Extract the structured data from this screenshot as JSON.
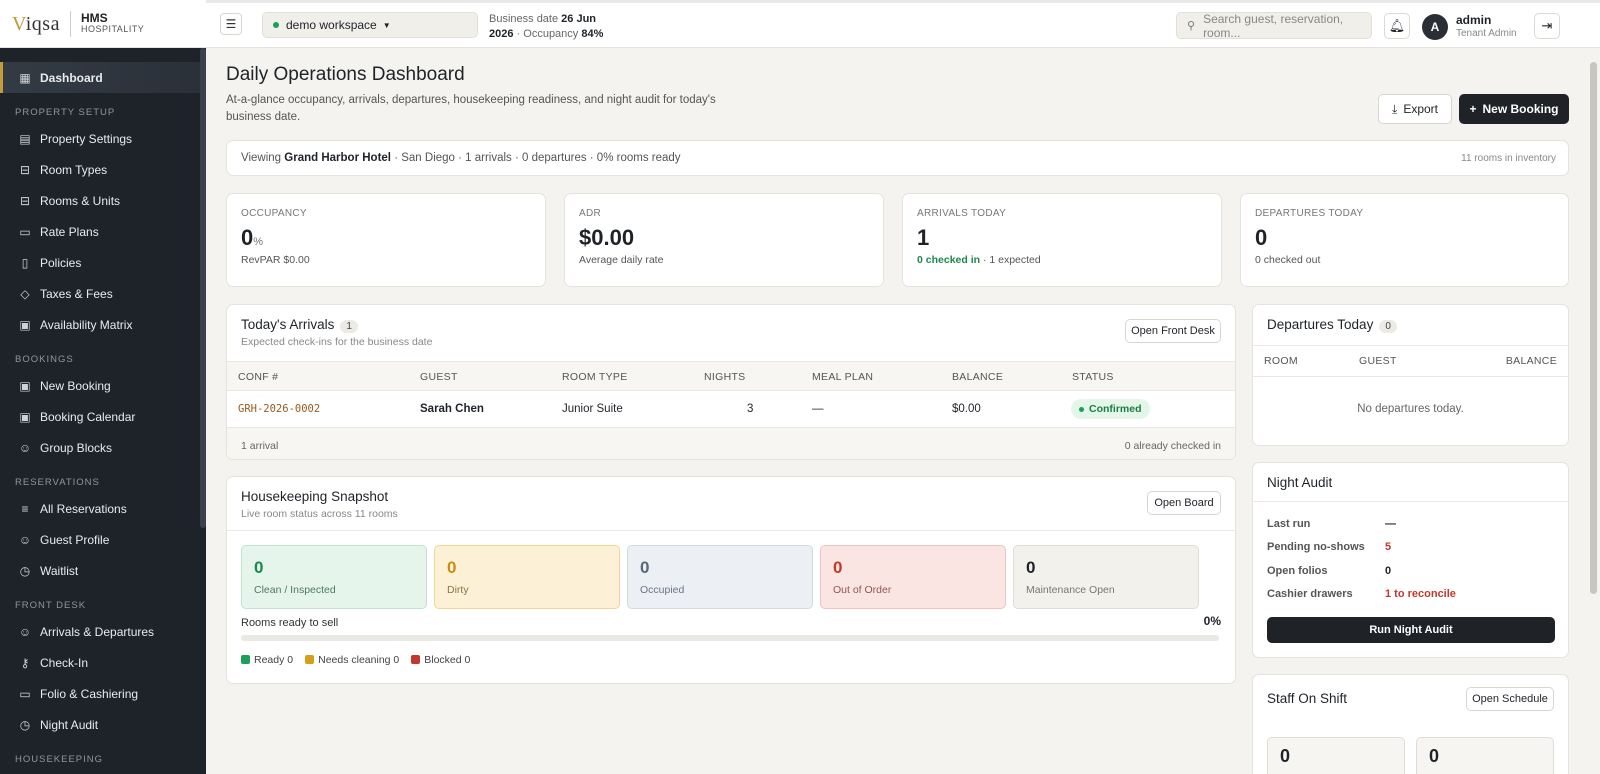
{
  "brand": {
    "logo_prefix": "V",
    "logo_rest": "iqsa",
    "name_line1": "HMS",
    "name_line2": "HOSPITALITY"
  },
  "sidebar": {
    "items": [
      {
        "label": "Dashboard"
      },
      {
        "section": "PROPERTY SETUP"
      },
      {
        "label": "Property Settings"
      },
      {
        "label": "Room Types"
      },
      {
        "label": "Rooms & Units"
      },
      {
        "label": "Rate Plans"
      },
      {
        "label": "Policies"
      },
      {
        "label": "Taxes & Fees"
      },
      {
        "label": "Availability Matrix"
      },
      {
        "section": "BOOKINGS"
      },
      {
        "label": "New Booking"
      },
      {
        "label": "Booking Calendar"
      },
      {
        "label": "Group Blocks"
      },
      {
        "section": "RESERVATIONS"
      },
      {
        "label": "All Reservations"
      },
      {
        "label": "Guest Profile"
      },
      {
        "label": "Waitlist"
      },
      {
        "section": "FRONT DESK"
      },
      {
        "label": "Arrivals & Departures"
      },
      {
        "label": "Check-In"
      },
      {
        "label": "Folio & Cashiering"
      },
      {
        "label": "Night Audit"
      },
      {
        "section": "HOUSEKEEPING"
      }
    ]
  },
  "topbar": {
    "workspace": "demo workspace",
    "business_date_label": "Business date",
    "business_date_value": "26 Jun",
    "business_year": "2026",
    "occupancy_label": "· Occupancy",
    "occupancy_value": "84%",
    "search_placeholder": "Search guest, reservation, room...",
    "avatar_initial": "A",
    "user_name": "admin",
    "user_role": "Tenant Admin"
  },
  "page": {
    "title": "Daily Operations Dashboard",
    "subtitle": "At-a-glance occupancy, arrivals, departures, housekeeping readiness, and night audit for today's business date.",
    "export_label": "Export",
    "new_booking_label": "New Booking"
  },
  "viewing": {
    "prefix": "Viewing",
    "hotel": "Grand Harbor Hotel",
    "details": "· San Diego · 1 arrivals · 0 departures · 0% rooms ready",
    "inventory": "11 rooms in inventory"
  },
  "kpis": {
    "occupancy": {
      "label": "OCCUPANCY",
      "value": "0",
      "unit": "%",
      "sub": "RevPAR $0.00"
    },
    "adr": {
      "label": "ADR",
      "value": "$0.00",
      "sub": "Average daily rate"
    },
    "arrivals": {
      "label": "ARRIVALS TODAY",
      "value": "1",
      "sub_green": "0 checked in",
      "sub_rest": "· 1 expected"
    },
    "departures": {
      "label": "DEPARTURES TODAY",
      "value": "0",
      "sub": "0 checked out"
    }
  },
  "arrivals": {
    "title": "Today's Arrivals",
    "count": "1",
    "subtitle": "Expected check-ins for the business date",
    "open_label": "Open Front Desk",
    "columns": [
      "CONF #",
      "GUEST",
      "ROOM TYPE",
      "NIGHTS",
      "MEAL PLAN",
      "BALANCE",
      "STATUS"
    ],
    "rows": [
      {
        "conf": "GRH-2026-0002",
        "guest": "Sarah Chen",
        "room_type": "Junior Suite",
        "nights": "3",
        "meal_plan": "—",
        "balance": "$0.00",
        "status": "Confirmed"
      }
    ],
    "footer_left": "1 arrival",
    "footer_right": "0 already checked in"
  },
  "housekeeping": {
    "title": "Housekeeping Snapshot",
    "subtitle": "Live room status across 11 rooms",
    "open_label": "Open Board",
    "boxes": [
      {
        "value": "0",
        "label": "Clean / Inspected"
      },
      {
        "value": "0",
        "label": "Dirty"
      },
      {
        "value": "0",
        "label": "Occupied"
      },
      {
        "value": "0",
        "label": "Out of Order"
      },
      {
        "value": "0",
        "label": "Maintenance Open"
      }
    ],
    "ready_label": "Rooms ready to sell",
    "ready_pct": "0%",
    "ready_fraction": 0,
    "legend": [
      {
        "label": "Ready 0",
        "color": "#1a9f5c"
      },
      {
        "label": "Needs cleaning 0",
        "color": "#d4a017"
      },
      {
        "label": "Blocked 0",
        "color": "#c0392b"
      }
    ]
  },
  "departures": {
    "title": "Departures Today",
    "count": "0",
    "columns": [
      "ROOM",
      "GUEST",
      "BALANCE"
    ],
    "empty": "No departures today."
  },
  "night_audit": {
    "title": "Night Audit",
    "rows": [
      {
        "key": "Last run",
        "value": "—"
      },
      {
        "key": "Pending no-shows",
        "value": "5"
      },
      {
        "key": "Open folios",
        "value": "0"
      },
      {
        "key": "Cashier drawers",
        "value": "1 to reconcile"
      }
    ],
    "run_label": "Run Night Audit"
  },
  "staff": {
    "title": "Staff On Shift",
    "open_label": "Open Schedule",
    "values": [
      "0",
      "0"
    ]
  },
  "colors": {
    "accent": "#c49a3a",
    "sidebar": "#1e2329",
    "success": "#1a9f5c",
    "danger": "#c0392b"
  }
}
